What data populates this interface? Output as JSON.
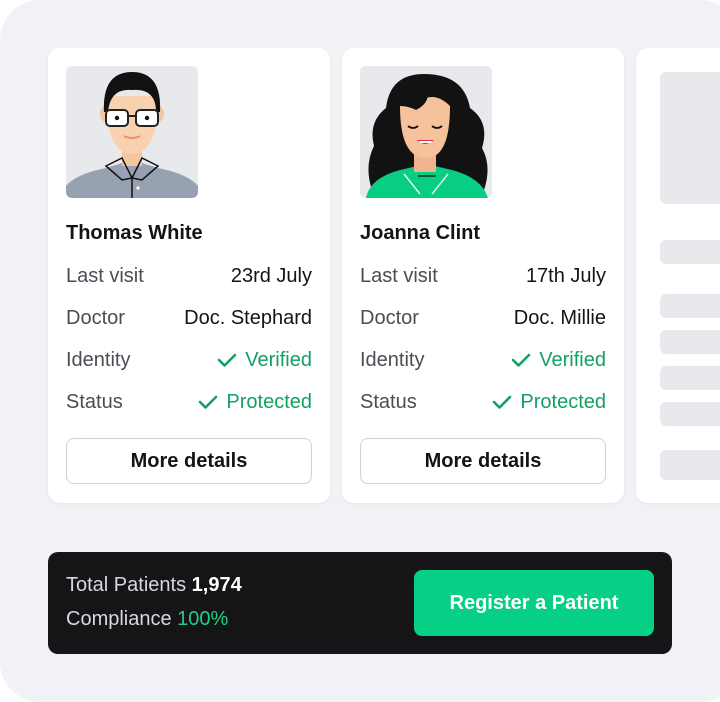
{
  "patients": [
    {
      "name": "Thomas White",
      "avatar_icon": "male-avatar-illustration",
      "fields": [
        {
          "label": "Last visit",
          "value": "23rd July"
        },
        {
          "label": "Doctor",
          "value": "Doc. Stephard"
        },
        {
          "label": "Identity",
          "value": "Verified",
          "icon": "check-icon"
        },
        {
          "label": "Status",
          "value": "Protected",
          "icon": "check-icon"
        }
      ],
      "button_label": "More details"
    },
    {
      "name": "Joanna Clint",
      "avatar_icon": "female-avatar-illustration",
      "fields": [
        {
          "label": "Last visit",
          "value": "17th July"
        },
        {
          "label": "Doctor",
          "value": "Doc. Millie"
        },
        {
          "label": "Identity",
          "value": "Verified",
          "icon": "check-icon"
        },
        {
          "label": "Status",
          "value": "Protected",
          "icon": "check-icon"
        }
      ],
      "button_label": "More details"
    }
  ],
  "summary": {
    "total_label": "Total Patients",
    "total_value": "1,974",
    "compliance_label": "Compliance",
    "compliance_value": "100%",
    "register_label": "Register a Patient"
  },
  "colors": {
    "accent_green": "#06cf86",
    "status_green": "#13a163",
    "footer_bg": "#151517",
    "panel_bg": "#f1f2f6"
  }
}
